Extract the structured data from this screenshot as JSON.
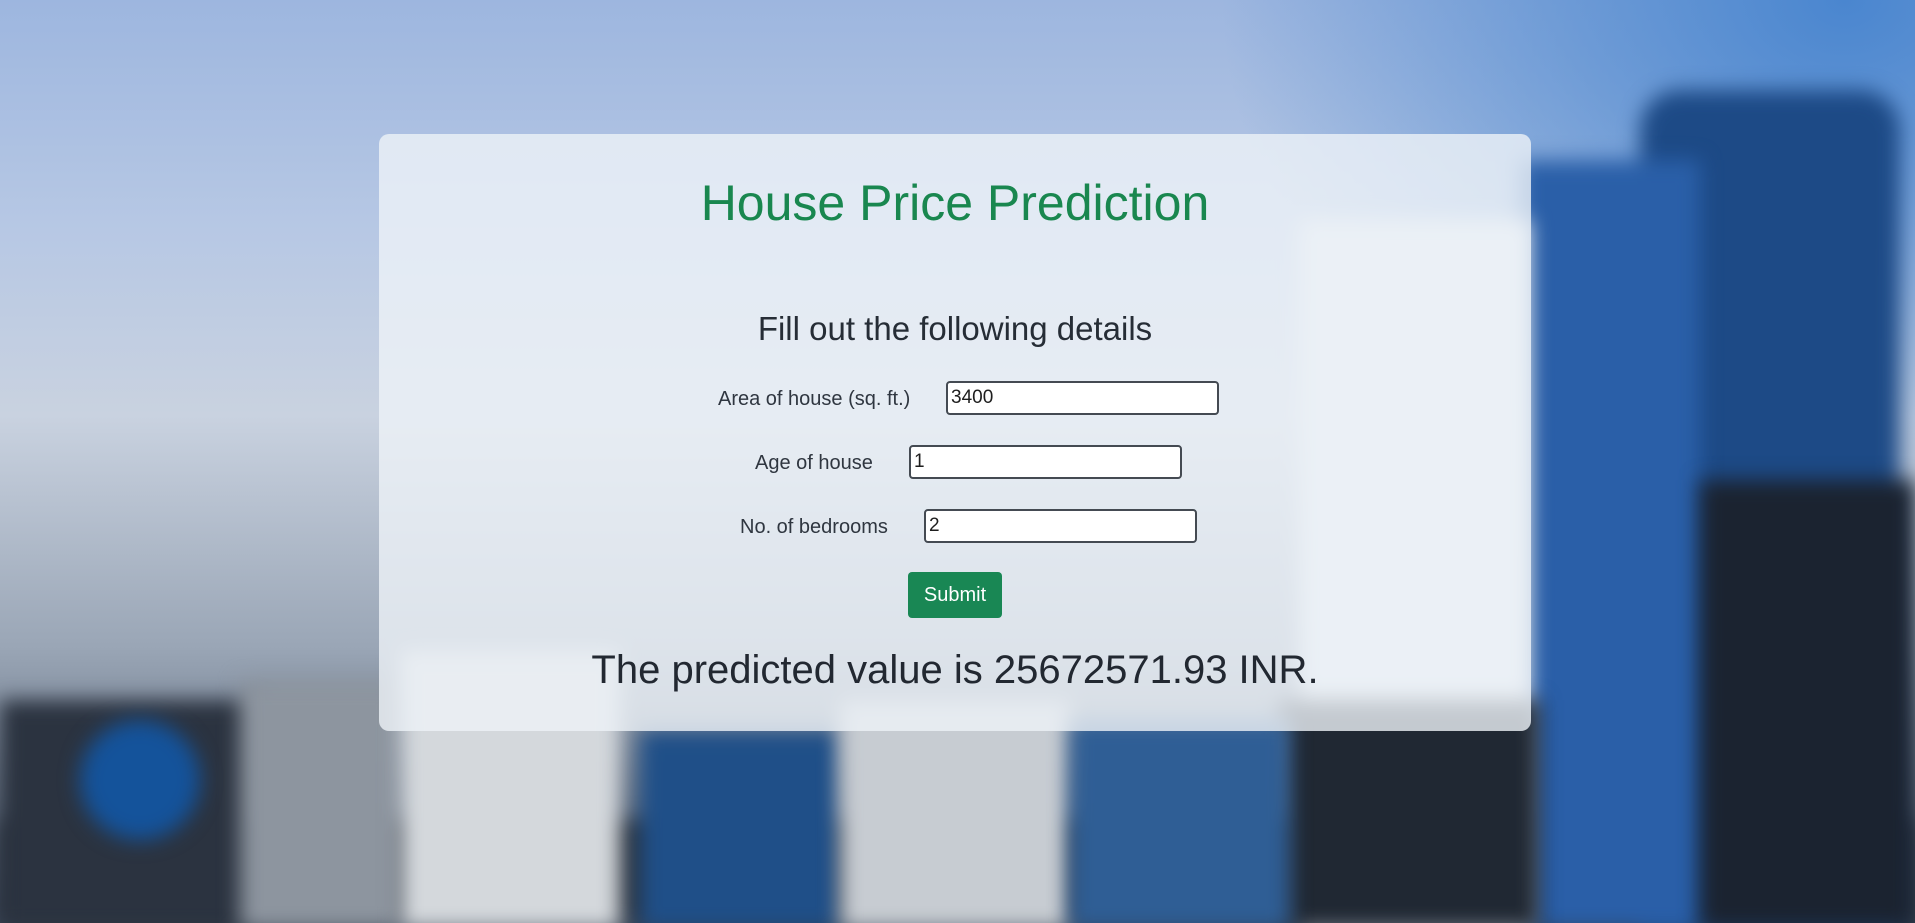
{
  "page": {
    "title": "House Price Prediction",
    "subtitle": "Fill out the following details"
  },
  "form": {
    "area": {
      "label": "Area of house (sq. ft.)",
      "value": "3400"
    },
    "age": {
      "label": "Age of house",
      "value": "1"
    },
    "bedrooms": {
      "label": "No. of bedrooms",
      "value": "2"
    },
    "submit_label": "Submit"
  },
  "result": {
    "text": "The predicted value is 25672571.93 INR."
  },
  "colors": {
    "accent": "#198754",
    "title": "#19874f",
    "text": "#262d36"
  }
}
